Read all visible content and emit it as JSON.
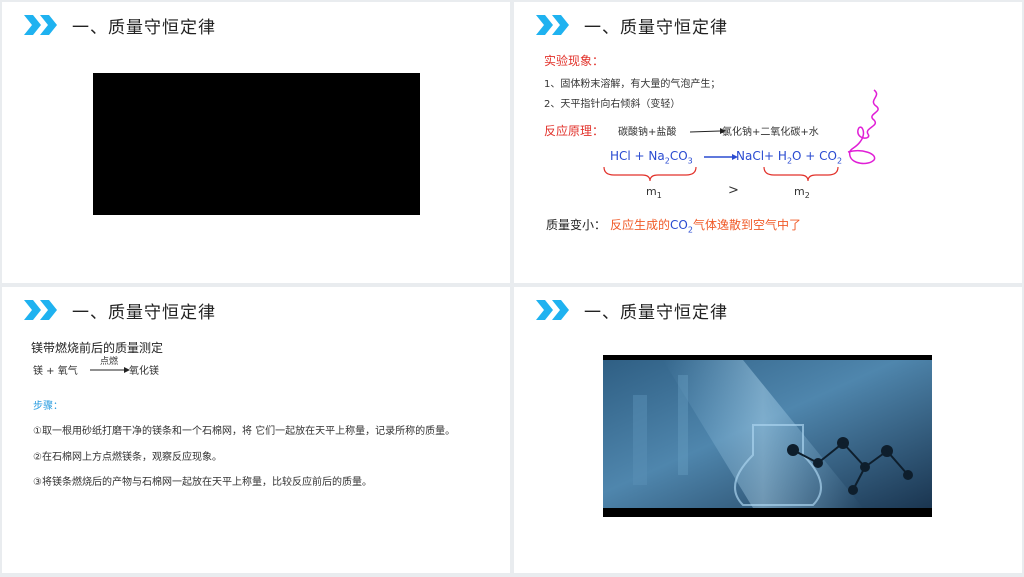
{
  "slide_title": "一、质量守恒定律",
  "slide2": {
    "phenomenon_label": "实验现象：",
    "phenomenon_1": "1、固体粉末溶解，有大量的气泡产生；",
    "phenomenon_2": "2、天平指针向右倾斜（变轻）",
    "principle_label": "反应原理：",
    "word_reactants": "碳酸钠+盐酸",
    "word_products": "氯化钠+二氧化碳+水",
    "m1": "m",
    "m2": "m",
    "compare": ">",
    "mass_label": "质量变小：",
    "mass_reason_a": "反应生成的",
    "mass_reason_b": "CO",
    "mass_reason_c": "气体逸散到空气中了"
  },
  "slide3": {
    "heading": "镁带燃烧前后的质量测定",
    "reactants": "镁 + 氧气",
    "condition": "点燃",
    "product": "氧化镁",
    "steps_label": "步骤：",
    "step_1": "①取一根用砂纸打磨干净的镁条和一个石棉网，将 它们一起放在天平上称量，记录所称的质量。",
    "step_2": "②在石棉网上方点燃镁条，观察反应现象。",
    "step_3": "③将镁条燃烧后的产物与石棉网一起放在天平上称量，比较反应前后的质量。"
  },
  "colors": {
    "accent": "#1fb2f0",
    "red": "#e2322b",
    "blue": "#2a4bd1",
    "orange": "#f05a28",
    "pen": "#e01ed6"
  },
  "icons": {
    "header": "double-chevron-icon"
  }
}
